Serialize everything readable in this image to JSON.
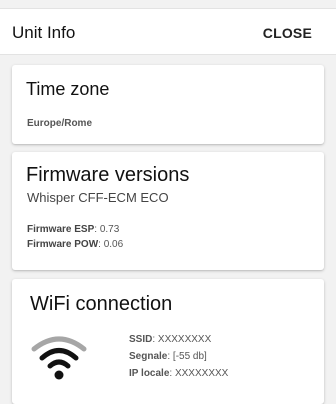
{
  "header": {
    "title": "Unit Info",
    "close_label": "CLOSE"
  },
  "timezone": {
    "heading": "Time zone",
    "value": "Europe/Rome"
  },
  "firmware": {
    "heading": "Firmware versions",
    "subtitle": "Whisper CFF-ECM ECO",
    "rows": [
      {
        "label": "Firmware ESP",
        "value": ": 0.73"
      },
      {
        "label": "Firmware POW",
        "value": ": 0.06"
      }
    ]
  },
  "wifi": {
    "heading": "WiFi connection",
    "icon": "wifi-signal-icon",
    "rows": [
      {
        "label": "SSID",
        "value": ": XXXXXXXX"
      },
      {
        "label": "Segnale",
        "value": ": [-55 db]"
      },
      {
        "label": "IP locale",
        "value": ": XXXXXXXX"
      }
    ]
  }
}
